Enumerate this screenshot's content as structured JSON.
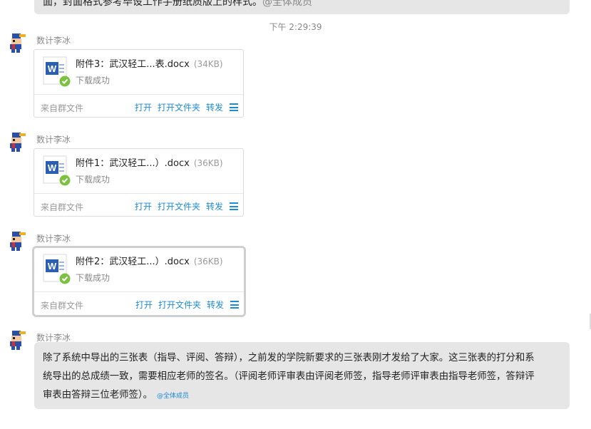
{
  "top_message": {
    "text": "面，封面格式参考毕设工作手册纸质版上的样式。",
    "mention": "@全体成员"
  },
  "timestamp": "下午 2:29:39",
  "messages": [
    {
      "sender": "数计李冰",
      "file": {
        "name": "附件3：武汉轻工...表.docx",
        "size": "(34KB)",
        "status": "下载成功",
        "source": "来自群文件",
        "actions": [
          "打开",
          "打开文件夹",
          "转发"
        ]
      }
    },
    {
      "sender": "数计李冰",
      "file": {
        "name": "附件1：武汉轻工...）.docx",
        "size": "(36KB)",
        "status": "下载成功",
        "source": "来自群文件",
        "actions": [
          "打开",
          "打开文件夹",
          "转发"
        ]
      }
    },
    {
      "sender": "数计李冰",
      "file": {
        "name": "附件2：武汉轻工...）.docx",
        "size": "(36KB)",
        "status": "下载成功",
        "source": "来自群文件",
        "actions": [
          "打开",
          "打开文件夹",
          "转发"
        ]
      }
    },
    {
      "sender": "数计李冰",
      "text_lines": [
        "除了系统中导出的三张表（指导、评阅、答辩），之前发的学院新要求的三张表刚才发给了大家。这三张表的打分和系",
        "统导出的总成绩一致，需要相应老师的签名。（评阅老师评审表由评阅老师签，指导老师评审表由指导老师签，答辩评",
        "审表由答辩三位老师签）。"
      ],
      "mention": "@全体成员"
    }
  ],
  "colors": {
    "bubble_bg": "#e6e6e6",
    "link": "#1e8bd4",
    "word_blue": "#2b5fb4",
    "success_green": "#7dc142"
  }
}
